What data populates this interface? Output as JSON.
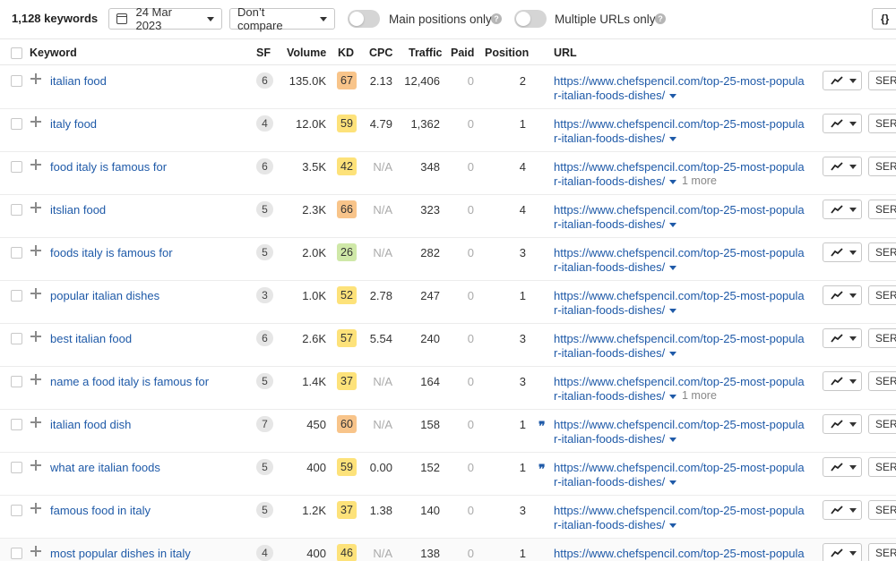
{
  "toolbar": {
    "keyword_count": "1,128 keywords",
    "date": "24 Mar 2023",
    "compare": "Don’t compare",
    "main_positions_label": "Main positions only",
    "multiple_urls_label": "Multiple URLs only",
    "help_glyph": "?",
    "json_label": "{}"
  },
  "columns": {
    "keyword": "Keyword",
    "sf": "SF",
    "volume": "Volume",
    "kd": "KD",
    "cpc": "CPC",
    "traffic": "Traffic",
    "paid": "Paid",
    "position": "Position",
    "url": "URL"
  },
  "kd_colors": {
    "orange": "#f8c48a",
    "yellow": "#fde27a",
    "green": "#cfe8a8"
  },
  "rows": [
    {
      "keyword": "italian food",
      "sf": "6",
      "volume": "135.0K",
      "kd": "67",
      "kd_color": "#f8c48a",
      "cpc": "2.13",
      "cpc_na": false,
      "traffic": "12,406",
      "paid": "0",
      "position": "2",
      "url_line1": "https://www.chefspencil.com/top-25-most-popula",
      "url_line2": "r-italian-foods-dishes/",
      "more": "",
      "quote": false,
      "serp": "SERP"
    },
    {
      "keyword": "italy food",
      "sf": "4",
      "volume": "12.0K",
      "kd": "59",
      "kd_color": "#fde27a",
      "cpc": "4.79",
      "cpc_na": false,
      "traffic": "1,362",
      "paid": "0",
      "position": "1",
      "url_line1": "https://www.chefspencil.com/top-25-most-popula",
      "url_line2": "r-italian-foods-dishes/",
      "more": "",
      "quote": false,
      "serp": "SERP"
    },
    {
      "keyword": "food italy is famous for",
      "sf": "6",
      "volume": "3.5K",
      "kd": "42",
      "kd_color": "#fde27a",
      "cpc": "N/A",
      "cpc_na": true,
      "traffic": "348",
      "paid": "0",
      "position": "4",
      "url_line1": "https://www.chefspencil.com/top-25-most-popula",
      "url_line2": "r-italian-foods-dishes/",
      "more": "1 more",
      "quote": false,
      "serp": "SERP"
    },
    {
      "keyword": "itslian food",
      "sf": "5",
      "volume": "2.3K",
      "kd": "66",
      "kd_color": "#f8c48a",
      "cpc": "N/A",
      "cpc_na": true,
      "traffic": "323",
      "paid": "0",
      "position": "4",
      "url_line1": "https://www.chefspencil.com/top-25-most-popula",
      "url_line2": "r-italian-foods-dishes/",
      "more": "",
      "quote": false,
      "serp": "SERP"
    },
    {
      "keyword": "foods italy is famous for",
      "sf": "5",
      "volume": "2.0K",
      "kd": "26",
      "kd_color": "#cfe8a8",
      "cpc": "N/A",
      "cpc_na": true,
      "traffic": "282",
      "paid": "0",
      "position": "3",
      "url_line1": "https://www.chefspencil.com/top-25-most-popula",
      "url_line2": "r-italian-foods-dishes/",
      "more": "",
      "quote": false,
      "serp": "SERP"
    },
    {
      "keyword": "popular italian dishes",
      "sf": "3",
      "volume": "1.0K",
      "kd": "52",
      "kd_color": "#fde27a",
      "cpc": "2.78",
      "cpc_na": false,
      "traffic": "247",
      "paid": "0",
      "position": "1",
      "url_line1": "https://www.chefspencil.com/top-25-most-popula",
      "url_line2": "r-italian-foods-dishes/",
      "more": "",
      "quote": false,
      "serp": "SERP"
    },
    {
      "keyword": "best italian food",
      "sf": "6",
      "volume": "2.6K",
      "kd": "57",
      "kd_color": "#fde27a",
      "cpc": "5.54",
      "cpc_na": false,
      "traffic": "240",
      "paid": "0",
      "position": "3",
      "url_line1": "https://www.chefspencil.com/top-25-most-popula",
      "url_line2": "r-italian-foods-dishes/",
      "more": "",
      "quote": false,
      "serp": "SERP"
    },
    {
      "keyword": "name a food italy is famous for",
      "sf": "5",
      "volume": "1.4K",
      "kd": "37",
      "kd_color": "#fde27a",
      "cpc": "N/A",
      "cpc_na": true,
      "traffic": "164",
      "paid": "0",
      "position": "3",
      "url_line1": "https://www.chefspencil.com/top-25-most-popula",
      "url_line2": "r-italian-foods-dishes/",
      "more": "1 more",
      "quote": false,
      "serp": "SERP"
    },
    {
      "keyword": "italian food dish",
      "sf": "7",
      "volume": "450",
      "kd": "60",
      "kd_color": "#f8c48a",
      "cpc": "N/A",
      "cpc_na": true,
      "traffic": "158",
      "paid": "0",
      "position": "1",
      "url_line1": "https://www.chefspencil.com/top-25-most-popula",
      "url_line2": "r-italian-foods-dishes/",
      "more": "",
      "quote": true,
      "serp": "SERP"
    },
    {
      "keyword": "what are italian foods",
      "sf": "5",
      "volume": "400",
      "kd": "59",
      "kd_color": "#fde27a",
      "cpc": "0.00",
      "cpc_na": false,
      "traffic": "152",
      "paid": "0",
      "position": "1",
      "url_line1": "https://www.chefspencil.com/top-25-most-popula",
      "url_line2": "r-italian-foods-dishes/",
      "more": "",
      "quote": true,
      "serp": "SERP"
    },
    {
      "keyword": "famous food in italy",
      "sf": "5",
      "volume": "1.2K",
      "kd": "37",
      "kd_color": "#fde27a",
      "cpc": "1.38",
      "cpc_na": false,
      "traffic": "140",
      "paid": "0",
      "position": "3",
      "url_line1": "https://www.chefspencil.com/top-25-most-popula",
      "url_line2": "r-italian-foods-dishes/",
      "more": "",
      "quote": false,
      "serp": "SERP"
    },
    {
      "keyword": "most popular dishes in italy",
      "sf": "4",
      "volume": "400",
      "kd": "46",
      "kd_color": "#fde27a",
      "cpc": "N/A",
      "cpc_na": true,
      "traffic": "138",
      "paid": "0",
      "position": "1",
      "url_line1": "https://www.chefspencil.com/top-25-most-popula",
      "url_line2": "",
      "more": "",
      "quote": false,
      "serp": "SERP"
    }
  ]
}
